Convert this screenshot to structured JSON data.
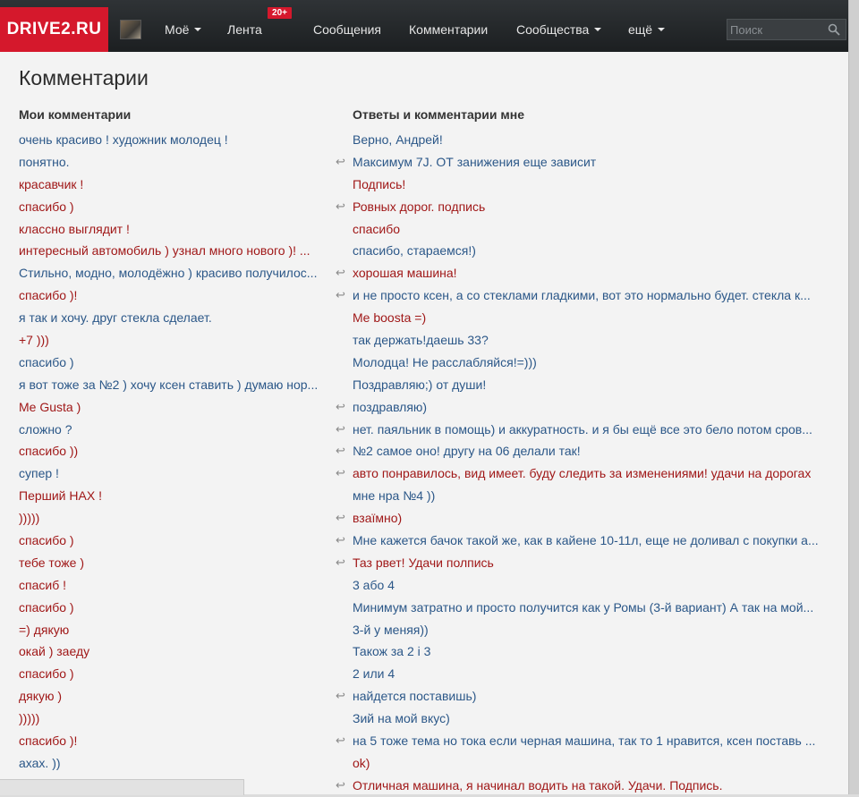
{
  "header": {
    "logo": "DRIVE2.RU",
    "nav": [
      {
        "label": "Моё",
        "dropdown": true
      },
      {
        "label": "Лента",
        "dropdown": false,
        "badge": "20+"
      },
      {
        "label": "Сообщения",
        "dropdown": false
      },
      {
        "label": "Комментарии",
        "dropdown": false
      },
      {
        "label": "Сообщества",
        "dropdown": true
      },
      {
        "label": "ещё",
        "dropdown": true
      }
    ],
    "search_placeholder": "Поиск"
  },
  "page": {
    "title": "Комментарии",
    "my_comments_heading": "Мои комментарии",
    "replies_heading": "Ответы и комментарии мне",
    "my_comments": [
      {
        "text": "очень красиво ! художник молодец !",
        "color": "blue"
      },
      {
        "text": "понятно.",
        "color": "blue"
      },
      {
        "text": "красавчик !",
        "color": "red"
      },
      {
        "text": "спасибо )",
        "color": "red"
      },
      {
        "text": "классно выглядит !",
        "color": "red"
      },
      {
        "text": "интересный автомобиль ) узнал много нового )! ...",
        "color": "red"
      },
      {
        "text": "Стильно, модно, молодёжно ) красиво получилос...",
        "color": "blue"
      },
      {
        "text": "спасибо )!",
        "color": "red"
      },
      {
        "text": "я так и хочу. друг стекла сделает.",
        "color": "blue"
      },
      {
        "text": "+7 )))",
        "color": "red"
      },
      {
        "text": "спасибо )",
        "color": "blue"
      },
      {
        "text": "я вот тоже за №2 ) хочу ксен ставить ) думаю нор...",
        "color": "blue"
      },
      {
        "text": "Me Gusta )",
        "color": "red"
      },
      {
        "text": "сложно ?",
        "color": "blue"
      },
      {
        "text": "спасибо ))",
        "color": "red"
      },
      {
        "text": "супер !",
        "color": "blue"
      },
      {
        "text": "Перший НАХ !",
        "color": "red"
      },
      {
        "text": ")))))",
        "color": "red"
      },
      {
        "text": "спасибо )",
        "color": "red"
      },
      {
        "text": "тебе тоже )",
        "color": "red"
      },
      {
        "text": "спасиб !",
        "color": "red"
      },
      {
        "text": "спасибо )",
        "color": "red"
      },
      {
        "text": "=) дякую",
        "color": "red"
      },
      {
        "text": "окай ) заеду",
        "color": "red"
      },
      {
        "text": "спасибо )",
        "color": "red"
      },
      {
        "text": "дякую )",
        "color": "red"
      },
      {
        "text": ")))))",
        "color": "red"
      },
      {
        "text": "спасибо )!",
        "color": "red"
      },
      {
        "text": "ахах. ))",
        "color": "blue"
      }
    ],
    "replies": [
      {
        "text": "Верно, Андрей!",
        "color": "blue",
        "reply": false
      },
      {
        "text": "Максимум 7J. ОТ занижения еще зависит",
        "color": "blue",
        "reply": true
      },
      {
        "text": "Подпись!",
        "color": "red",
        "reply": false
      },
      {
        "text": "Ровных дорог. подпись",
        "color": "red",
        "reply": true
      },
      {
        "text": "спасибо",
        "color": "red",
        "reply": false
      },
      {
        "text": "спасибо, стараемся!)",
        "color": "blue",
        "reply": false
      },
      {
        "text": "хорошая машина!",
        "color": "red",
        "reply": true
      },
      {
        "text": "и не просто ксен, а со стеклами гладкими, вот это нормально будет. стекла к...",
        "color": "blue",
        "reply": true
      },
      {
        "text": "Me boosta =)",
        "color": "red",
        "reply": false
      },
      {
        "text": "так держать!даешь 33?",
        "color": "blue",
        "reply": false
      },
      {
        "text": "Молодца! Не расслабляйся!=)))",
        "color": "blue",
        "reply": false
      },
      {
        "text": "Поздравляю;) от души!",
        "color": "blue",
        "reply": false
      },
      {
        "text": "поздравляю)",
        "color": "blue",
        "reply": true
      },
      {
        "text": "нет. паяльник в помощь) и аккуратность. и я бы ещё все это бело потом сров...",
        "color": "blue",
        "reply": true
      },
      {
        "text": "№2 самое оно! другу на 06 делали так!",
        "color": "blue",
        "reply": true
      },
      {
        "text": "авто понравилось, вид имеет. буду следить за изменениями! удачи на дорогах",
        "color": "red",
        "reply": true
      },
      {
        "text": "мне нра №4 ))",
        "color": "blue",
        "reply": false
      },
      {
        "text": "взаїмно)",
        "color": "red",
        "reply": true
      },
      {
        "text": "Мне кажется бачок такой же, как в кайене 10-11л, еще не доливал с покупки а...",
        "color": "blue",
        "reply": true
      },
      {
        "text": "Таз рвет! Удачи полпись",
        "color": "red",
        "reply": true
      },
      {
        "text": "3 або 4",
        "color": "blue",
        "reply": false
      },
      {
        "text": "Минимум затратно и просто получится как у Ромы (3-й вариант) А так на мой...",
        "color": "blue",
        "reply": false
      },
      {
        "text": "3-й у меняя))",
        "color": "blue",
        "reply": false
      },
      {
        "text": "Також за 2 і 3",
        "color": "blue",
        "reply": false
      },
      {
        "text": "2 или 4",
        "color": "blue",
        "reply": false
      },
      {
        "text": "найдется поставишь)",
        "color": "blue",
        "reply": true
      },
      {
        "text": "Зий на мой вкус)",
        "color": "blue",
        "reply": false
      },
      {
        "text": "на 5 тоже тема но тока если черная машина, так то 1 нравится, ксен поставь ...",
        "color": "blue",
        "reply": true
      },
      {
        "text": "ok)",
        "color": "red",
        "reply": false
      },
      {
        "text": "Отличная машина, я начинал водить на такой. Удачи. Подпись.",
        "color": "red",
        "reply": true
      }
    ]
  }
}
